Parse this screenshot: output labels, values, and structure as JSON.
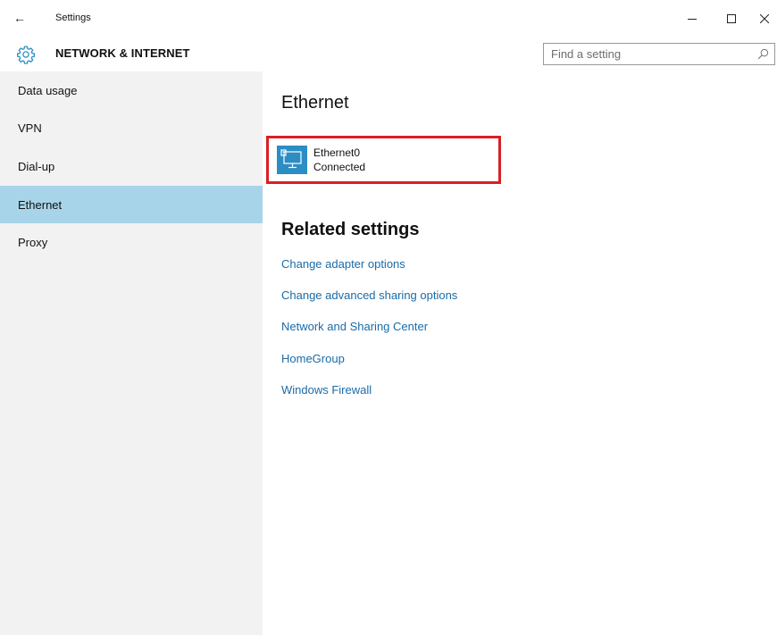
{
  "window": {
    "back_glyph": "←",
    "title": "Settings"
  },
  "header": {
    "icon": "gear-icon",
    "title": "NETWORK & INTERNET",
    "search_placeholder": "Find a setting"
  },
  "sidebar": {
    "items": [
      {
        "label": "Data usage",
        "selected": false
      },
      {
        "label": "VPN",
        "selected": false
      },
      {
        "label": "Dial-up",
        "selected": false
      },
      {
        "label": "Ethernet",
        "selected": true
      },
      {
        "label": "Proxy",
        "selected": false
      }
    ]
  },
  "main": {
    "heading": "Ethernet",
    "device": {
      "icon": "ethernet-monitor-icon",
      "name": "Ethernet0",
      "status": "Connected"
    },
    "related_heading": "Related settings",
    "related_links": [
      "Change adapter options",
      "Change advanced sharing options",
      "Network and Sharing Center",
      "HomeGroup",
      "Windows Firewall"
    ]
  },
  "colors": {
    "accent": "#2b8dc4",
    "selected_nav": "#a7d4e8",
    "sidebar_bg": "#f2f2f2",
    "link": "#1a6ba8",
    "highlight_border": "#d91f26"
  }
}
